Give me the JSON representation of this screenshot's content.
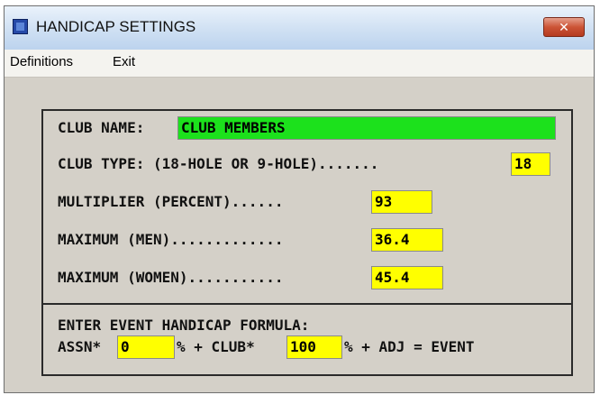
{
  "window": {
    "title": "HANDICAP SETTINGS",
    "close_label": "✕"
  },
  "menu": {
    "items": [
      "Definitions",
      "Exit"
    ]
  },
  "form": {
    "club_name_label": "CLUB NAME:",
    "club_name_value": "CLUB MEMBERS",
    "club_type_label": "CLUB TYPE: (18-HOLE OR 9-HOLE).......",
    "club_type_value": "18",
    "multiplier_label": "MULTIPLIER (PERCENT)......",
    "multiplier_value": "93",
    "max_men_label": "MAXIMUM (MEN).............",
    "max_men_value": "36.4",
    "max_women_label": "MAXIMUM (WOMEN)...........",
    "max_women_value": "45.4",
    "formula_heading": "ENTER EVENT HANDICAP FORMULA:",
    "assn_label": "ASSN*",
    "assn_value": "0",
    "assn_suffix": "% + CLUB*",
    "club_value": "100",
    "club_suffix": "% + ADJ = EVENT"
  },
  "colors": {
    "field_yellow": "#ffff00",
    "field_green": "#1ce11c",
    "panel_bg": "#d4d0c8"
  }
}
